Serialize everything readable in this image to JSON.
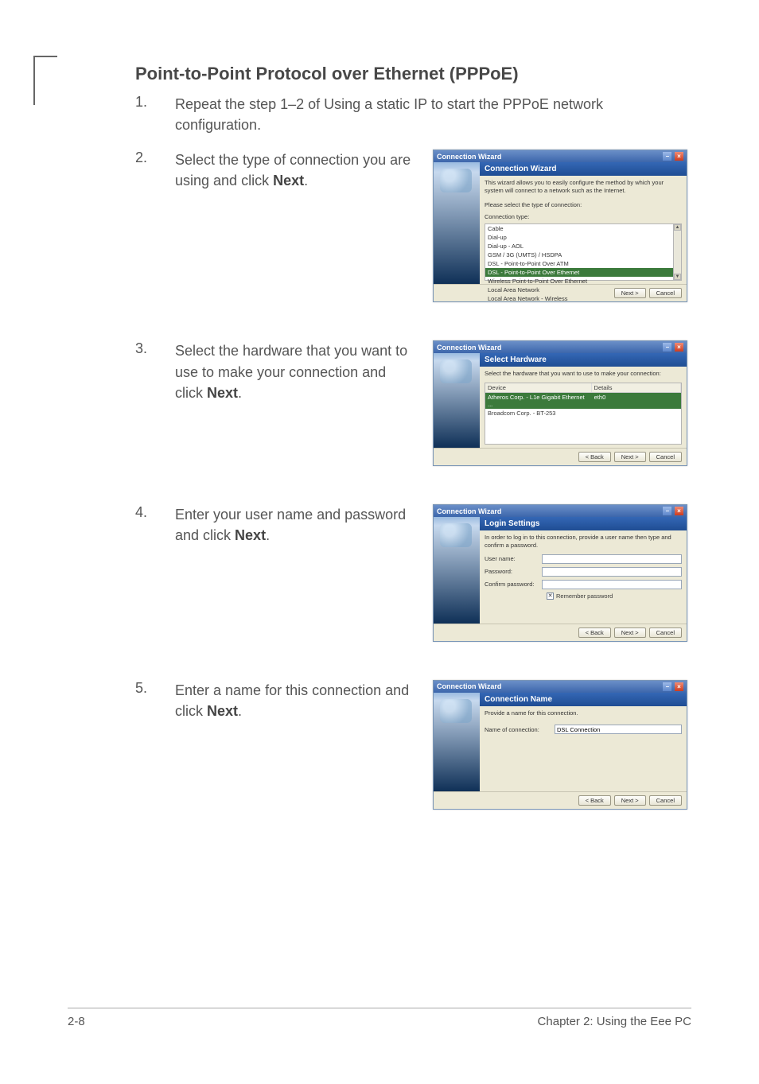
{
  "heading": "Point-to-Point Protocol over Ethernet (PPPoE)",
  "steps": [
    {
      "num": "1.",
      "text_before": "Repeat the step 1–2 of Using a static IP to start the PPPoE network configuration.",
      "bold": ""
    },
    {
      "num": "2.",
      "text_before": "Select the type of connection you are using and click ",
      "bold": "Next",
      "text_after": "."
    },
    {
      "num": "3.",
      "text_before": "Select the hardware that you want to use to make your connection and click ",
      "bold": "Next",
      "text_after": "."
    },
    {
      "num": "4.",
      "text_before": "Enter your user name and password and click ",
      "bold": "Next",
      "text_after": "."
    },
    {
      "num": "5.",
      "text_before": "Enter a name for this connection and click ",
      "bold": "Next",
      "text_after": "."
    }
  ],
  "wiz_common": {
    "title": "Connection Wizard",
    "btn_back": "< Back",
    "btn_next": "Next >",
    "btn_cancel": "Cancel"
  },
  "wiz1": {
    "banner": "Connection Wizard",
    "desc": "This wizard allows you to easily configure the method by which your system will connect to a network such as the Internet.",
    "prompt": "Please select the type of connection:",
    "label": "Connection type:",
    "options": [
      "Cable",
      "Dial-up",
      "Dial-up - AOL",
      "GSM / 3G (UMTS) / HSDPA",
      "DSL - Point-to-Point Over ATM",
      "DSL - Point-to-Point Over Ethernet",
      "Wireless Point-to-Point Over Ethernet",
      "Local Area Network",
      "Local Area Network - Wireless"
    ],
    "selected_index": 5
  },
  "wiz2": {
    "banner": "Select Hardware",
    "desc": "Select the hardware that you want to use to make your connection:",
    "col1": "Device",
    "col2": "Details",
    "rows": [
      {
        "device": "Atheros Corp. - L1e Gigabit Ethernet ...",
        "details": "eth0",
        "selected": true
      },
      {
        "device": "Broadcom Corp. - BT-253",
        "details": "",
        "selected": false
      }
    ]
  },
  "wiz3": {
    "banner": "Login Settings",
    "desc": "In order to log in to this connection, provide a user name then type and confirm a password.",
    "user_label": "User name:",
    "pass_label": "Password:",
    "confirm_label": "Confirm password:",
    "remember": "Remember password"
  },
  "wiz4": {
    "banner": "Connection Name",
    "desc": "Provide a name for this connection.",
    "name_label": "Name of connection:",
    "name_value": "DSL Connection"
  },
  "footer": {
    "left": "2-8",
    "right": "Chapter 2: Using the Eee PC"
  }
}
